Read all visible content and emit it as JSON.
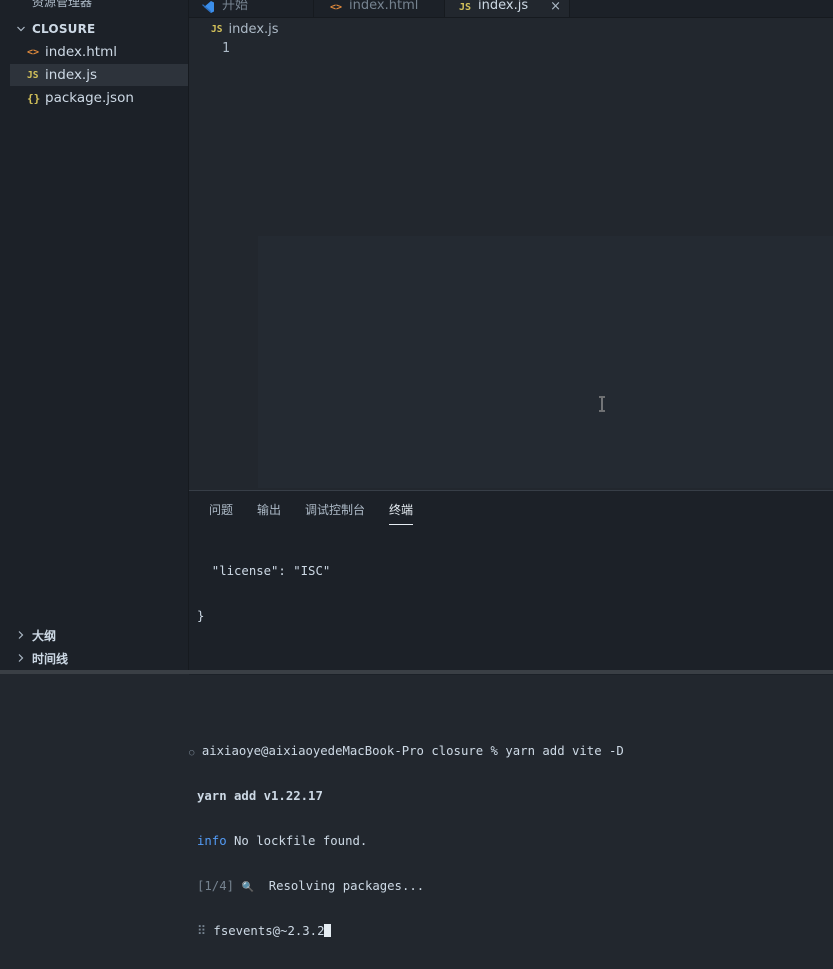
{
  "sidebar": {
    "header": "资源管理器",
    "more": "···",
    "folder": "CLOSURE",
    "files": [
      {
        "icon": "<>",
        "name": "index.html",
        "kind": "html"
      },
      {
        "icon": "JS",
        "name": "index.js",
        "kind": "js"
      },
      {
        "icon": "{}",
        "name": "package.json",
        "kind": "json"
      }
    ],
    "outline": "大纲",
    "timeline": "时间线"
  },
  "tabs": [
    {
      "icon": "vscode-icon",
      "label": "开始"
    },
    {
      "icon": "<>",
      "label": "index.html"
    },
    {
      "icon": "JS",
      "label": "index.js",
      "close": "×"
    }
  ],
  "editor": {
    "breadcrumb_icon": "JS",
    "breadcrumb_file": "index.js",
    "line_number": "1"
  },
  "panel": {
    "tabs": [
      "问题",
      "输出",
      "调试控制台",
      "终端"
    ],
    "active_tab": "终端",
    "terminal": {
      "l1": "  \"license\": \"ISC\"",
      "l2": "}",
      "prompt_marker": "○",
      "l3": "aixiaoye@aixiaoyedeMacBook-Pro closure % yarn add vite -D",
      "l4": "yarn add v1.22.17",
      "l5_prefix": "info",
      "l5_rest": " No lockfile found.",
      "l6_step": "[1/4]",
      "l6_icon": "🔍",
      "l6_rest": "  Resolving packages...",
      "l7_prefix": "⠿",
      "l7_rest": " fsevents@~2.3.2"
    }
  },
  "colors": {
    "accent_js": "#d4c25a",
    "accent_html": "#e08a3c",
    "info": "#539bf5"
  }
}
